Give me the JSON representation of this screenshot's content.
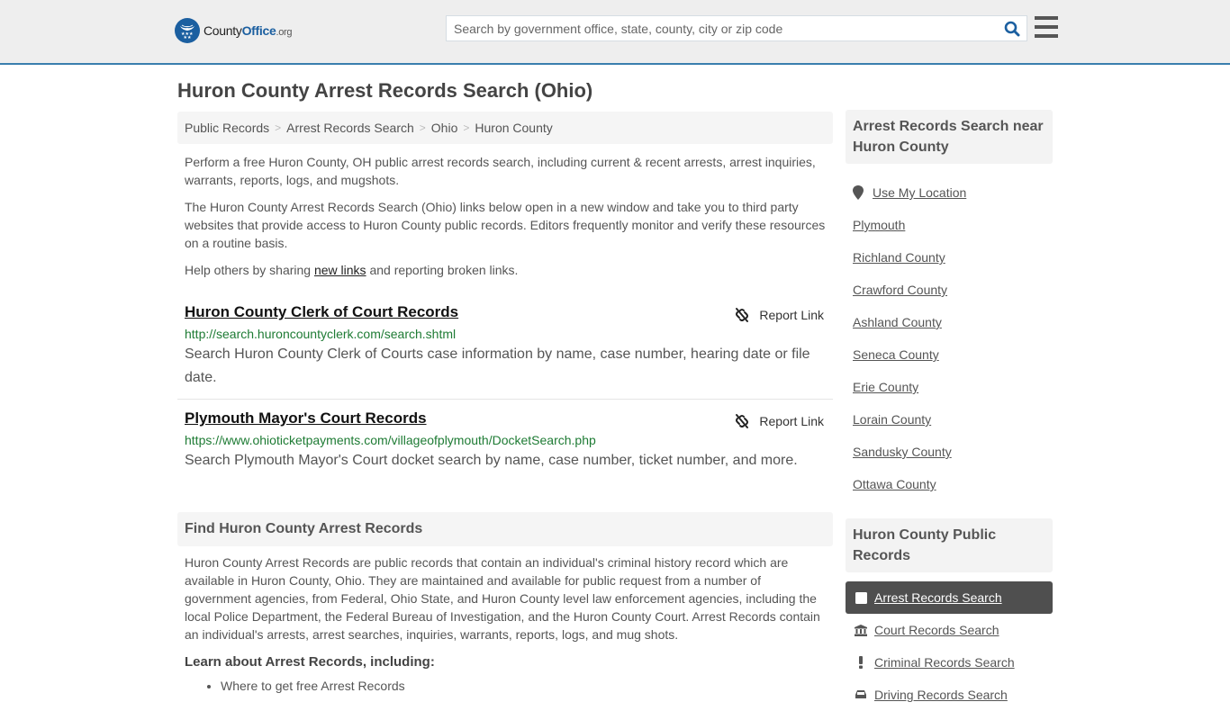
{
  "header": {
    "logo": {
      "county": "County",
      "office": "Office",
      "org": ".org"
    },
    "search": {
      "placeholder": "Search by government office, state, county, city or zip code",
      "value": ""
    },
    "search_icon": "search-icon",
    "menu_icon": "hamburger-menu-icon"
  },
  "page": {
    "title": "Huron County Arrest Records Search (Ohio)",
    "breadcrumb": [
      {
        "label": "Public Records"
      },
      {
        "label": "Arrest Records Search"
      },
      {
        "label": "Ohio"
      },
      {
        "label": "Huron County"
      }
    ],
    "breadcrumb_separator": ">",
    "intro": {
      "p1": "Perform a free Huron County, OH public arrest records search, including current & recent arrests, arrest inquiries, warrants, reports, logs, and mugshots.",
      "p2": "The Huron County Arrest Records Search (Ohio) links below open in a new window and take you to third party websites that provide access to Huron County public records. Editors frequently monitor and verify these resources on a routine basis.",
      "p3_before": "Help others by sharing ",
      "p3_link": "new links",
      "p3_after": " and reporting broken links."
    },
    "results": [
      {
        "title": "Huron County Clerk of Court Records",
        "url": "http://search.huroncountyclerk.com/search.shtml",
        "description": "Search Huron County Clerk of Courts case information by name, case number, hearing date or file date.",
        "report_label": "Report Link"
      },
      {
        "title": "Plymouth Mayor's Court Records",
        "url": "https://www.ohioticketpayments.com/villageofplymouth/DocketSearch.php",
        "description": "Search Plymouth Mayor's Court docket search by name, case number, ticket number, and more.",
        "report_label": "Report Link"
      }
    ],
    "find_section": {
      "heading": "Find Huron County Arrest Records",
      "body": "Huron County Arrest Records are public records that contain an individual's criminal history record which are available in Huron County, Ohio. They are maintained and available for public request from a number of government agencies, from Federal, Ohio State, and Huron County level law enforcement agencies, including the local Police Department, the Federal Bureau of Investigation, and the Huron County Court. Arrest Records contain an individual's arrests, arrest searches, inquiries, warrants, reports, logs, and mug shots.",
      "learn_heading": "Learn about Arrest Records, including:",
      "learn_items": [
        "Where to get free Arrest Records"
      ]
    }
  },
  "sidebar": {
    "near_heading": "Arrest Records Search near Huron County",
    "use_location": "Use My Location",
    "near_items": [
      "Plymouth",
      "Richland County",
      "Crawford County",
      "Ashland County",
      "Seneca County",
      "Erie County",
      "Lorain County",
      "Sandusky County",
      "Ottawa County"
    ],
    "public_heading": "Huron County Public Records",
    "public_items": [
      {
        "label": "Arrest Records Search",
        "icon": "square-icon",
        "active": true
      },
      {
        "label": "Court Records Search",
        "icon": "courthouse-icon",
        "active": false
      },
      {
        "label": "Criminal Records Search",
        "icon": "exclamation-icon",
        "active": false
      },
      {
        "label": "Driving Records Search",
        "icon": "car-icon",
        "active": false
      }
    ]
  },
  "colors": {
    "brand_blue": "#1b5fa0",
    "header_border": "#3a7fae",
    "url_green": "#1e7b34",
    "active_item_bg": "#4f4f4f"
  }
}
